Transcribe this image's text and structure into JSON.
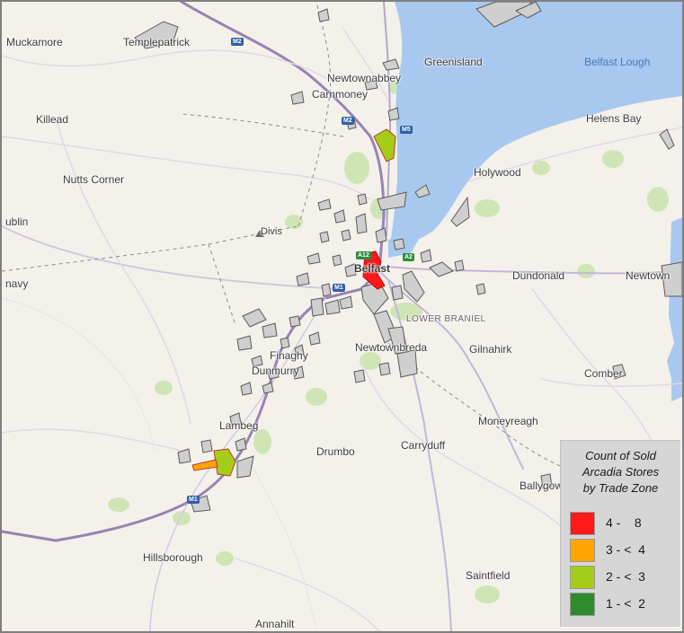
{
  "map": {
    "water_label": "Belfast Lough",
    "place_labels": [
      {
        "key": "muckamore",
        "text": "Muckamore"
      },
      {
        "key": "templepatrick",
        "text": "Templepatrick"
      },
      {
        "key": "newtownabbey",
        "text": "Newtownabbey"
      },
      {
        "key": "greenisland",
        "text": "Greenisland"
      },
      {
        "key": "carnmoney",
        "text": "Carnmoney"
      },
      {
        "key": "killead",
        "text": "Killead"
      },
      {
        "key": "helens_bay",
        "text": "Helens Bay"
      },
      {
        "key": "holywood",
        "text": "Holywood"
      },
      {
        "key": "nutts_corner",
        "text": "Nutts Corner"
      },
      {
        "key": "dublin",
        "text": "ublin"
      },
      {
        "key": "divis",
        "text": "Divis"
      },
      {
        "key": "belfast",
        "text": "Belfast"
      },
      {
        "key": "dundonald",
        "text": "Dundonald"
      },
      {
        "key": "newtown",
        "text": "Newtown"
      },
      {
        "key": "navy",
        "text": "navy"
      },
      {
        "key": "lower_braniel",
        "text": "LOWER BRANIEL"
      },
      {
        "key": "newtownbreda",
        "text": "Newtownbreda"
      },
      {
        "key": "gilnahirk",
        "text": "Gilnahirk"
      },
      {
        "key": "finaghy",
        "text": "Finaghy"
      },
      {
        "key": "dunmurry",
        "text": "Dunmurry"
      },
      {
        "key": "comber",
        "text": "Comber"
      },
      {
        "key": "lambeg",
        "text": "Lambeg"
      },
      {
        "key": "moneyreagh",
        "text": "Moneyreagh"
      },
      {
        "key": "drumbo",
        "text": "Drumbo"
      },
      {
        "key": "carryduff",
        "text": "Carryduff"
      },
      {
        "key": "ballygowan",
        "text": "Ballygow"
      },
      {
        "key": "hillsborough",
        "text": "Hillsborough"
      },
      {
        "key": "saintfield",
        "text": "Saintfield"
      },
      {
        "key": "annahilt",
        "text": "Annahilt"
      }
    ],
    "road_shields": [
      {
        "key": "m2_top",
        "text": "M2",
        "color": "blue"
      },
      {
        "key": "m2_mid",
        "text": "M2",
        "color": "blue"
      },
      {
        "key": "m5",
        "text": "M5",
        "color": "blue"
      },
      {
        "key": "a12",
        "text": "A12",
        "color": "green"
      },
      {
        "key": "a2",
        "text": "A2",
        "color": "green"
      },
      {
        "key": "m1_city",
        "text": "M1",
        "color": "blue"
      },
      {
        "key": "m1_south",
        "text": "M1",
        "color": "blue"
      }
    ],
    "zone_colors": {
      "gray": "#cfcfcf",
      "red": "#ff1a1a",
      "orange": "#ffa500",
      "yellowgreen": "#9acd1e",
      "green": "#2e8b2e"
    },
    "water_color": "#a8c8ef"
  },
  "legend": {
    "title_line1": "Count of Sold",
    "title_line2": "Arcadia Stores",
    "title_line3": "by Trade Zone",
    "items": [
      {
        "range": "4 -    8",
        "color": "#ff1a1a"
      },
      {
        "range": "3 - <  4",
        "color": "#ffa500"
      },
      {
        "range": "2 - <  3",
        "color": "#a6cc1a"
      },
      {
        "range": "1 - <  2",
        "color": "#2e8b2e"
      }
    ]
  }
}
